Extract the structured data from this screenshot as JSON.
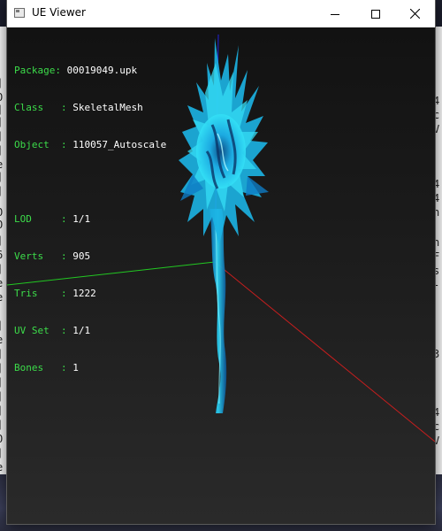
{
  "window": {
    "title": "UE Viewer"
  },
  "info": {
    "package_label": "Package: ",
    "package": "00019049.upk",
    "class_label": "Class   : ",
    "class": "SkeletalMesh",
    "object_label": "Object  : ",
    "object": "110057_Autoscale",
    "lod_label": "LOD     : ",
    "lod": "1/1",
    "verts_label": "Verts   : ",
    "verts": "905",
    "tris_label": "Tris    : ",
    "tris": "1222",
    "uvset_label": "UV Set  : ",
    "uvset": "1/1",
    "bones_label": "Bones   : ",
    "bones": "1"
  },
  "colors": {
    "info_key": "#3cdc4a",
    "info_value": "#ffffff",
    "axis_x": "#c81e1e",
    "axis_y": "#22c822",
    "axis_z": "#2020e0",
    "mesh": "#1fb6e0"
  }
}
